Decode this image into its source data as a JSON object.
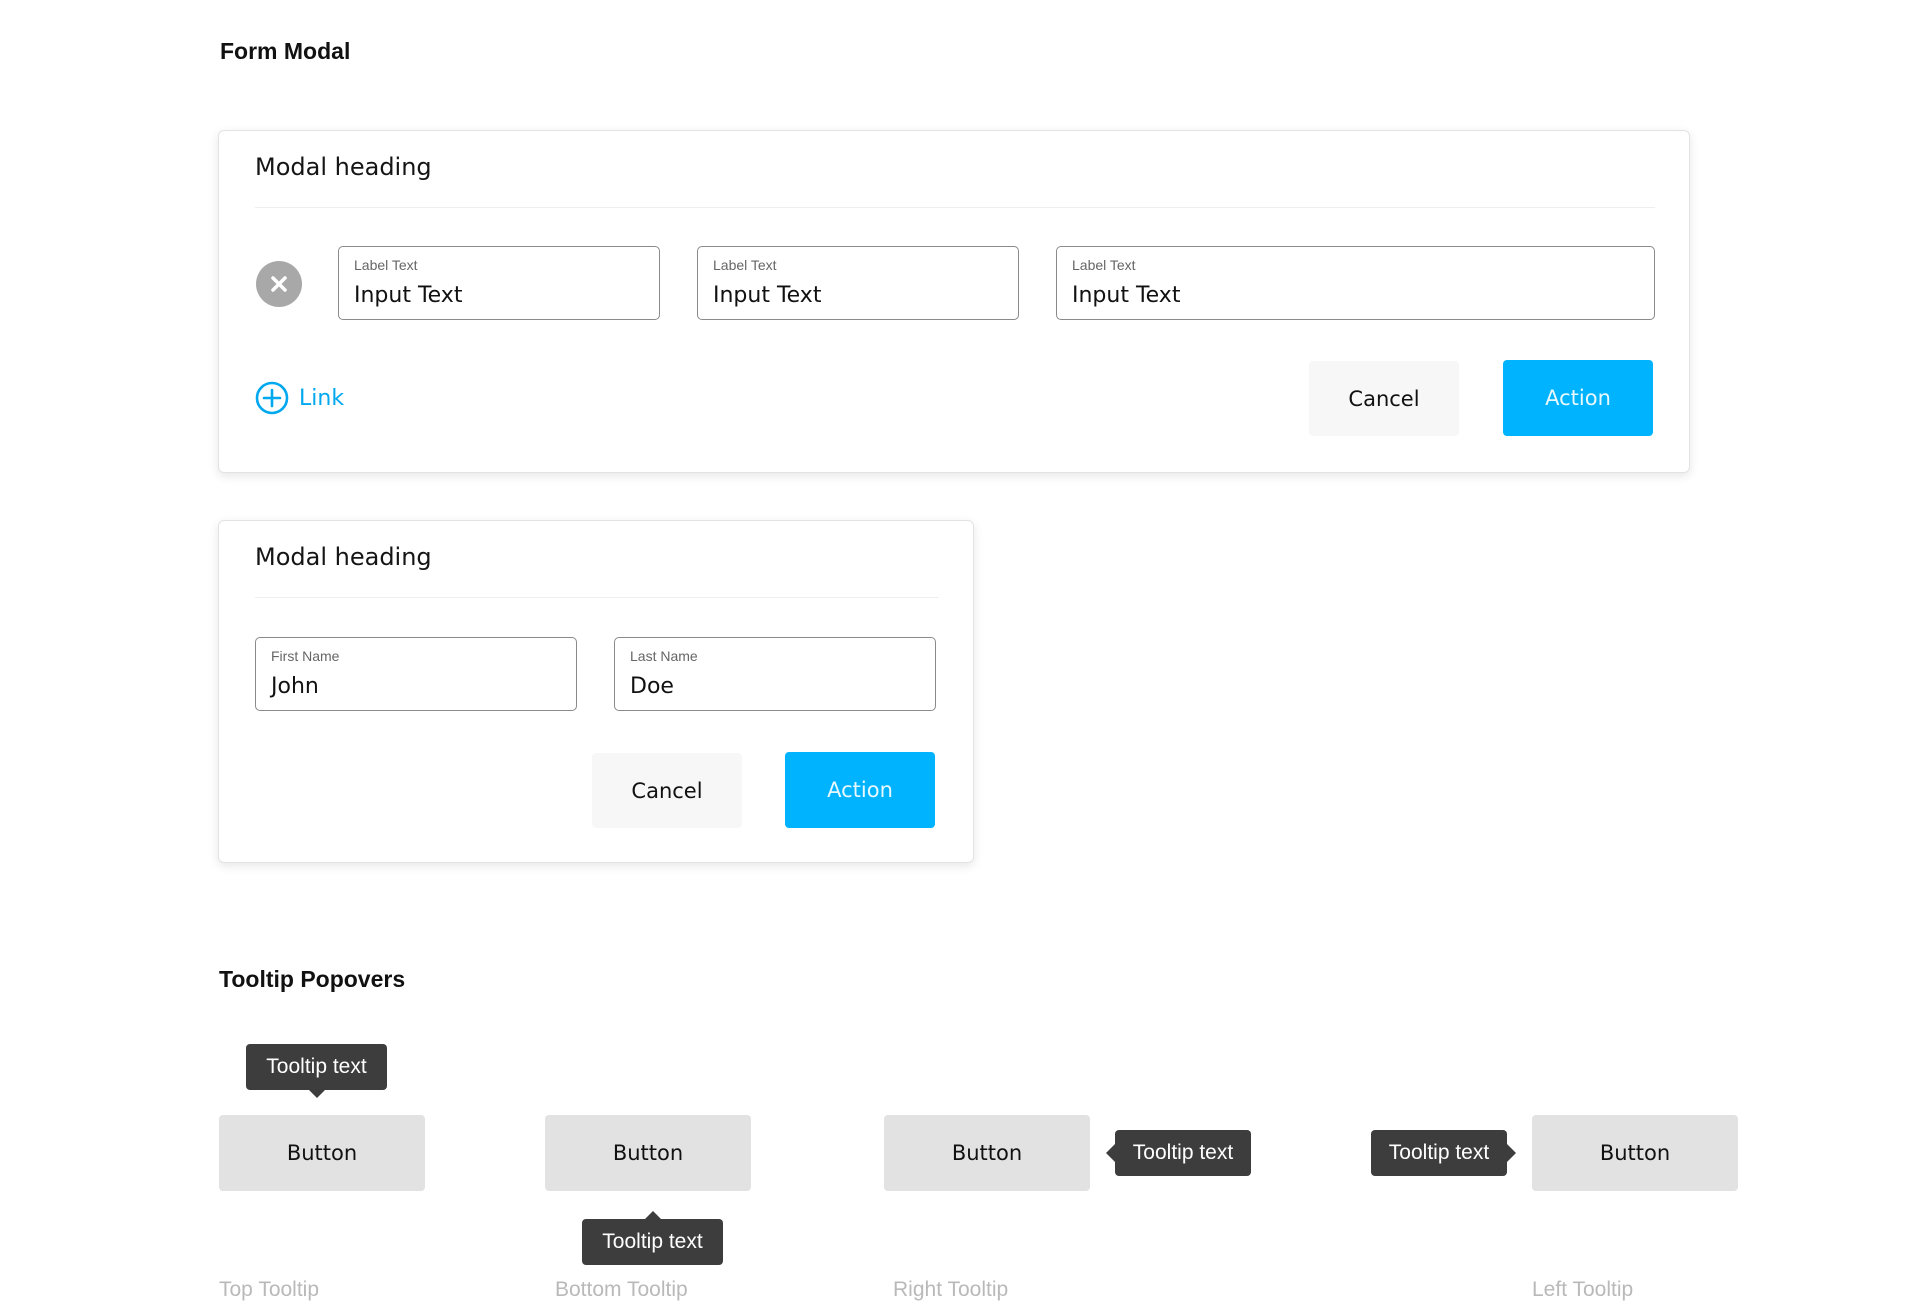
{
  "form_section": {
    "title": "Form Modal"
  },
  "modal_1": {
    "heading": "Modal heading",
    "fields": [
      {
        "label": "Label Text",
        "value": "Input Text"
      },
      {
        "label": "Label Text",
        "value": "Input Text"
      },
      {
        "label": "Label Text",
        "value": "Input Text"
      }
    ],
    "link_label": "Link",
    "cancel_label": "Cancel",
    "action_label": "Action"
  },
  "modal_2": {
    "heading": "Modal heading",
    "fields": [
      {
        "label": "First Name",
        "value": "John"
      },
      {
        "label": "Last Name",
        "value": "Doe"
      }
    ],
    "cancel_label": "Cancel",
    "action_label": "Action"
  },
  "tooltip_section": {
    "title": "Tooltip Popovers",
    "examples": [
      {
        "button_label": "Button",
        "tooltip": "Tooltip text",
        "caption": "Top Tooltip"
      },
      {
        "button_label": "Button",
        "tooltip": "Tooltip text",
        "caption": "Bottom Tooltip"
      },
      {
        "button_label": "Button",
        "tooltip": "Tooltip text",
        "caption": "Right Tooltip"
      },
      {
        "button_label": "Button",
        "tooltip": "Tooltip text",
        "caption": "Left Tooltip"
      }
    ]
  },
  "colors": {
    "accent": "#00b3ff",
    "tooltip_bg": "#3d3d3d",
    "button_gray": "#e2e2e2",
    "cancel_bg": "#f7f7f7",
    "caption": "#b9b9b9"
  },
  "icons": {
    "remove": "close-circle-icon",
    "add": "plus-circle-icon"
  }
}
